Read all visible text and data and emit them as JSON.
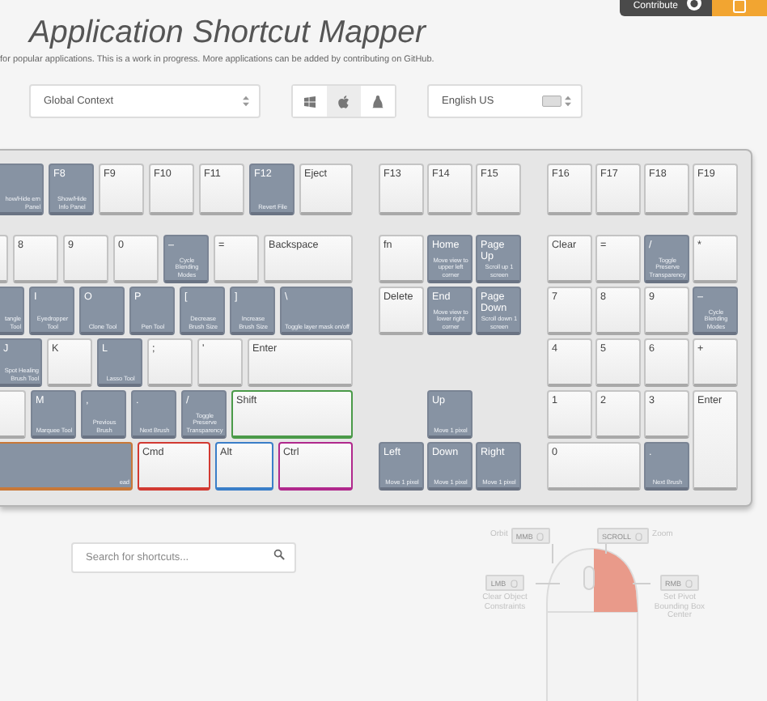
{
  "header": {
    "contribute_button": "Contribute",
    "title": "Application Shortcut Mapper",
    "subtitle": "for popular applications. This is a work in progress. More applications can be added by contributing on GitHub."
  },
  "controls": {
    "context_select": "Global Context",
    "os_options": [
      {
        "kind": "windows",
        "selected": false
      },
      {
        "kind": "apple",
        "selected": true
      },
      {
        "kind": "linux",
        "selected": false
      }
    ],
    "language_select": "English US"
  },
  "keyboard": {
    "blocks": [
      {
        "kind": "main",
        "function_row": [
          {
            "kind": "cut",
            "mapped": true,
            "action": "how/Hide ern Panel"
          },
          {
            "kind": "std",
            "mapped": true,
            "label": "F8",
            "action": "Show/Hide Info Panel"
          },
          {
            "kind": "std",
            "mapped": false,
            "label": "F9"
          },
          {
            "kind": "std",
            "mapped": false,
            "label": "F10"
          },
          {
            "kind": "std",
            "mapped": false,
            "label": "F11"
          },
          {
            "kind": "std",
            "mapped": true,
            "label": "F12",
            "action": "Revert File"
          },
          {
            "kind": "eject",
            "mapped": false,
            "label": "Eject"
          }
        ],
        "rows": [
          {
            "keys": [
              {
                "kind": "cut",
                "mapped": false
              },
              {
                "kind": "std",
                "mapped": false,
                "label": "8"
              },
              {
                "kind": "std",
                "mapped": false,
                "label": "9"
              },
              {
                "kind": "std",
                "mapped": false,
                "label": "0"
              },
              {
                "kind": "std",
                "mapped": true,
                "label": "–",
                "action": "Cycle Blending Modes"
              },
              {
                "kind": "std",
                "mapped": false,
                "label": "="
              },
              {
                "kind": "backspace",
                "mapped": false,
                "label": "Backspace"
              }
            ]
          },
          {
            "keys": [
              {
                "kind": "cut",
                "mapped": true,
                "action": "tangle Tool"
              },
              {
                "kind": "std",
                "mapped": true,
                "label": "I",
                "action": "Eyedropper Tool"
              },
              {
                "kind": "std",
                "mapped": true,
                "label": "O",
                "action": "Clone Tool"
              },
              {
                "kind": "std",
                "mapped": true,
                "label": "P",
                "action": "Pen Tool"
              },
              {
                "kind": "std",
                "mapped": true,
                "label": "[",
                "action": "Decrease Brush Size"
              },
              {
                "kind": "std",
                "mapped": true,
                "label": "]",
                "action": "Increase Brush Size"
              },
              {
                "kind": "backslash",
                "mapped": true,
                "label": "\\",
                "action": "Toggle layer mask on/off"
              }
            ]
          },
          {
            "keys": [
              {
                "kind": "cut",
                "mapped": true,
                "label": "J",
                "action": "Spot Healing Brush Tool"
              },
              {
                "kind": "std",
                "mapped": false,
                "label": "K"
              },
              {
                "kind": "std",
                "mapped": true,
                "label": "L",
                "action": "Lasso Tool"
              },
              {
                "kind": "std",
                "mapped": false,
                "label": ";"
              },
              {
                "kind": "std",
                "mapped": false,
                "label": "'"
              },
              {
                "kind": "enter",
                "mapped": false,
                "label": "Enter"
              }
            ]
          },
          {
            "keys": [
              {
                "kind": "cut",
                "mapped": false
              },
              {
                "kind": "std",
                "mapped": true,
                "label": "M",
                "action": "Marquee Tool"
              },
              {
                "kind": "std",
                "mapped": true,
                "label": ",",
                "action": "Previous Brush"
              },
              {
                "kind": "std",
                "mapped": true,
                "label": ".",
                "action": "Next Brush"
              },
              {
                "kind": "std",
                "mapped": true,
                "label": "/",
                "action": "Toggle Preserve Transparency"
              },
              {
                "kind": "shift",
                "mapped": false,
                "label": "Shift",
                "color": "#4a9a48"
              }
            ]
          },
          {
            "keys": [
              {
                "kind": "cut",
                "mapped": true,
                "action": "ead",
                "color": "#c87838"
              },
              {
                "kind": "cmd",
                "mapped": false,
                "label": "Cmd",
                "color": "#d23a32"
              },
              {
                "kind": "alt",
                "mapped": false,
                "label": "Alt",
                "color": "#3a7ec8"
              },
              {
                "kind": "ctrl",
                "mapped": false,
                "label": "Ctrl",
                "color": "#b0288c"
              }
            ]
          }
        ]
      },
      {
        "kind": "grid",
        "function_row": [
          {
            "kind": "std",
            "mapped": false,
            "label": "F13"
          },
          {
            "kind": "std",
            "mapped": false,
            "label": "F14"
          },
          {
            "kind": "std",
            "mapped": false,
            "label": "F15"
          }
        ],
        "keys": [
          {
            "kind": "std",
            "mapped": false,
            "label": "fn"
          },
          {
            "kind": "std",
            "mapped": true,
            "label": "Home",
            "action": "Move view to upper left corner"
          },
          {
            "kind": "std",
            "mapped": true,
            "label": "Page Up",
            "action": "Scroll up 1 screen"
          },
          {
            "kind": "std",
            "mapped": false,
            "label": "Delete"
          },
          {
            "kind": "std",
            "mapped": true,
            "label": "End",
            "action": "Move view to lower right corner"
          },
          {
            "kind": "std",
            "mapped": true,
            "label": "Page Down",
            "action": "Scroll down 1 screen"
          },
          {
            "kind": "blank"
          },
          {
            "kind": "blank"
          },
          {
            "kind": "blank"
          },
          {
            "kind": "blank"
          },
          {
            "kind": "std",
            "mapped": true,
            "label": "Up",
            "action": "Move 1 pixel"
          },
          {
            "kind": "blank"
          },
          {
            "kind": "std",
            "mapped": true,
            "label": "Left",
            "action": "Move 1 pixel"
          },
          {
            "kind": "std",
            "mapped": true,
            "label": "Down",
            "action": "Move 1 pixel"
          },
          {
            "kind": "std",
            "mapped": true,
            "label": "Right",
            "action": "Move 1 pixel"
          }
        ]
      },
      {
        "kind": "grid",
        "function_row": [
          {
            "kind": "std",
            "mapped": false,
            "label": "F16"
          },
          {
            "kind": "std",
            "mapped": false,
            "label": "F17"
          },
          {
            "kind": "std",
            "mapped": false,
            "label": "F18"
          },
          {
            "kind": "std",
            "mapped": false,
            "label": "F19"
          }
        ],
        "keys": [
          {
            "kind": "std",
            "mapped": false,
            "label": "Clear"
          },
          {
            "kind": "std",
            "mapped": false,
            "label": "="
          },
          {
            "kind": "std",
            "mapped": true,
            "label": "/",
            "action": "Toggle Preserve Transparency"
          },
          {
            "kind": "std",
            "mapped": false,
            "label": "*"
          },
          {
            "kind": "std",
            "mapped": false,
            "label": "7"
          },
          {
            "kind": "std",
            "mapped": false,
            "label": "8"
          },
          {
            "kind": "std",
            "mapped": false,
            "label": "9"
          },
          {
            "kind": "std",
            "mapped": true,
            "label": "–",
            "action": "Cycle Blending Modes"
          },
          {
            "kind": "std",
            "mapped": false,
            "label": "4"
          },
          {
            "kind": "std",
            "mapped": false,
            "label": "5"
          },
          {
            "kind": "std",
            "mapped": false,
            "label": "6"
          },
          {
            "kind": "std",
            "mapped": false,
            "label": "+"
          },
          {
            "kind": "std",
            "mapped": false,
            "label": "1"
          },
          {
            "kind": "std",
            "mapped": false,
            "label": "2"
          },
          {
            "kind": "std",
            "mapped": false,
            "label": "3"
          },
          {
            "kind": "tall",
            "mapped": false,
            "label": "Enter"
          },
          {
            "kind": "double",
            "mapped": false,
            "label": "0"
          },
          {
            "kind": "std",
            "mapped": true,
            "label": ".",
            "action": "Next Brush"
          }
        ]
      }
    ]
  },
  "search": {
    "placeholder": "Search for shortcuts..."
  },
  "mouse_legend": [
    {
      "kind": "top-left",
      "label": "Orbit",
      "badge": "MMB"
    },
    {
      "kind": "top-right",
      "badge": "SCROLL",
      "label": "Zoom"
    },
    {
      "kind": "left",
      "badge": "LMB",
      "label": "Clear Object Constraints"
    },
    {
      "kind": "right",
      "badge": "RMB",
      "label": "Set Pivot Bounding Box Center"
    }
  ]
}
